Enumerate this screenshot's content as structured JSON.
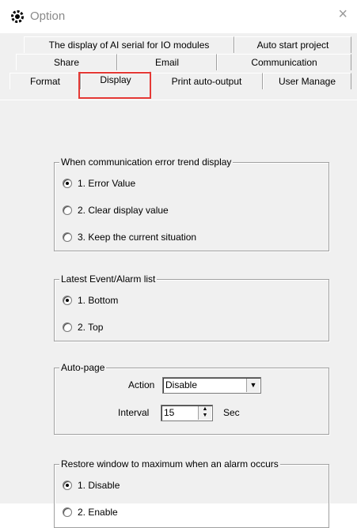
{
  "window": {
    "title": "Option",
    "close_glyph": "×",
    "icon": "gear-app-icon"
  },
  "tabs": {
    "row1": [
      "The display of AI serial for IO modules",
      "Auto start project"
    ],
    "row2": [
      "Share",
      "Email",
      "Communication"
    ],
    "row3": [
      "Format",
      "Display",
      "Print auto-output",
      "User Manage"
    ],
    "active": "Display"
  },
  "groups": {
    "comm_error": {
      "title": "When communication error trend display",
      "options": [
        "1. Error Value",
        "2. Clear display value",
        "3. Keep the current situation"
      ],
      "selected_index": 0
    },
    "event_list": {
      "title": "Latest Event/Alarm list",
      "options": [
        "1. Bottom",
        "2. Top"
      ],
      "selected_index": 0
    },
    "auto_page": {
      "title": "Auto-page",
      "action_label": "Action",
      "action_value": "Disable",
      "interval_label": "Interval",
      "interval_value": "15",
      "interval_unit": "Sec"
    },
    "restore": {
      "title": "Restore window to maximum when an alarm occurs",
      "options": [
        "1. Disable",
        "2. Enable"
      ],
      "selected_index": 0
    }
  },
  "colors": {
    "highlight": "#e53935",
    "dialog_bg": "#f0f0f0"
  }
}
